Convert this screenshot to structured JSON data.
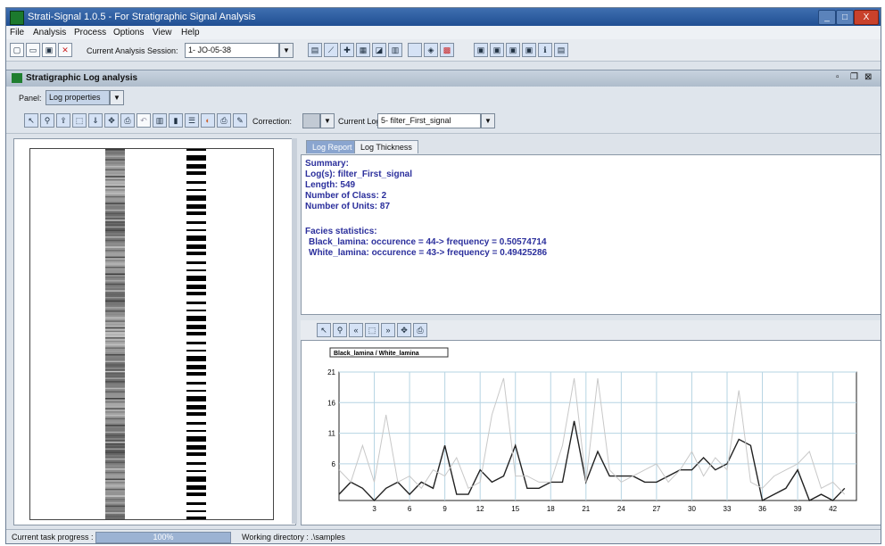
{
  "window": {
    "title": "Strati-Signal 1.0.5 - For Stratigraphic Signal Analysis"
  },
  "menu": [
    "File",
    "Analysis",
    "Process",
    "Options",
    "View",
    "Help"
  ],
  "toolbar": {
    "session_label": "Current Analysis Session:",
    "session_value": "1- JO-05-38"
  },
  "inner_window": {
    "title": "Stratigraphic Log analysis"
  },
  "panel": {
    "label": "Panel:",
    "value": "Log properties"
  },
  "log_toolbar": {
    "correction_label": "Correction:",
    "current_log_label": "Current Log:",
    "current_log_value": "5- filter_First_signal"
  },
  "tabs": [
    "Log Report",
    "Log Thickness"
  ],
  "report": {
    "summary": "Summary:",
    "logs": "Log(s): filter_First_signal",
    "length": "Length: 549",
    "classes": "Number of Class: 2",
    "units": "Number of Units: 87",
    "facies": "Facies statistics:",
    "black": "Black_lamina: occurence = 44-> frequency = 0.50574714",
    "white": "White_lamina: occurence = 43-> frequency = 0.49425286"
  },
  "statusbar": {
    "progress_label": "Current task progress :",
    "progress_text": "100%",
    "progress": 1.0,
    "working_dir": "Working directory : .\\samples"
  },
  "chart_data": {
    "type": "line",
    "legend": "Black_lamina / White_lamina",
    "xticks": [
      3,
      6,
      9,
      12,
      15,
      18,
      21,
      24,
      27,
      30,
      33,
      36,
      39,
      42
    ],
    "yticks": [
      6,
      11,
      16,
      21
    ],
    "ylim": [
      0,
      21
    ],
    "xlim": [
      0,
      44
    ],
    "series": [
      {
        "name": "Black_lamina",
        "color": "#222222",
        "x": [
          0,
          1,
          2,
          3,
          4,
          5,
          6,
          7,
          8,
          9,
          10,
          11,
          12,
          13,
          14,
          15,
          16,
          17,
          18,
          19,
          20,
          21,
          22,
          23,
          24,
          25,
          26,
          27,
          28,
          29,
          30,
          31,
          32,
          33,
          34,
          35,
          36,
          37,
          38,
          39,
          40,
          41,
          42,
          43
        ],
        "values": [
          1,
          3,
          2,
          0,
          2,
          3,
          1,
          3,
          2,
          9,
          1,
          1,
          5,
          3,
          4,
          9,
          2,
          2,
          3,
          3,
          13,
          3,
          8,
          4,
          4,
          4,
          3,
          3,
          4,
          5,
          5,
          7,
          5,
          6,
          10,
          9,
          0,
          1,
          2,
          5,
          0,
          1,
          0,
          2
        ]
      },
      {
        "name": "White_lamina",
        "color": "#c8c8c8",
        "x": [
          0,
          1,
          2,
          3,
          4,
          5,
          6,
          7,
          8,
          9,
          10,
          11,
          12,
          13,
          14,
          15,
          16,
          17,
          18,
          19,
          20,
          21,
          22,
          23,
          24,
          25,
          26,
          27,
          28,
          29,
          30,
          31,
          32,
          33,
          34,
          35,
          36,
          37,
          38,
          39,
          40,
          41,
          42,
          43
        ],
        "values": [
          5,
          3,
          9,
          3,
          14,
          3,
          4,
          2,
          5,
          4,
          7,
          2,
          3,
          14,
          20,
          4,
          4,
          3,
          3,
          9,
          20,
          3,
          20,
          5,
          3,
          4,
          5,
          6,
          3,
          5,
          8,
          4,
          7,
          5,
          18,
          3,
          2,
          4,
          5,
          6,
          8,
          2,
          3,
          1
        ]
      }
    ]
  }
}
